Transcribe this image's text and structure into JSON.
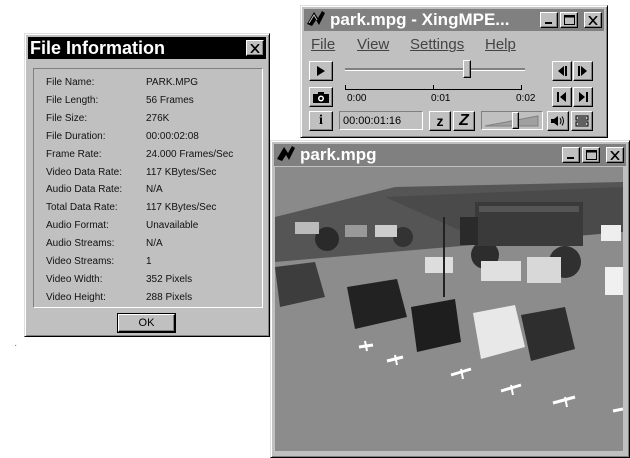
{
  "file_info": {
    "title": "File Information",
    "close_label": "✕",
    "rows": [
      {
        "label": "File Name:",
        "value": "PARK.MPG"
      },
      {
        "label": "File Length:",
        "value": "56 Frames"
      },
      {
        "label": "File Size:",
        "value": "276K"
      },
      {
        "label": "File Duration:",
        "value": "00:00:02:08"
      },
      {
        "label": "Frame Rate:",
        "value": "24.000 Frames/Sec"
      },
      {
        "label": "Video Data Rate:",
        "value": "117 KBytes/Sec"
      },
      {
        "label": "Audio Data Rate:",
        "value": "N/A"
      },
      {
        "label": "Total Data Rate:",
        "value": "117 KBytes/Sec"
      },
      {
        "label": "Audio Format:",
        "value": "Unavailable"
      },
      {
        "label": "Audio Streams:",
        "value": "N/A"
      },
      {
        "label": "Video Streams:",
        "value": "1"
      },
      {
        "label": "Video Width:",
        "value": "352 Pixels"
      },
      {
        "label": "Video Height:",
        "value": "288 Pixels"
      }
    ],
    "ok_label": "OK"
  },
  "player": {
    "title": "park.mpg - XingMPE...",
    "menu": [
      "File",
      "View",
      "Settings",
      "Help"
    ],
    "time_marks": [
      "0:00",
      "0:01",
      "0:02"
    ],
    "position_display": "00:00:01:16",
    "zoom_small_label": "z",
    "zoom_large_label": "Z",
    "seek_position_fraction": 0.68,
    "volume_fraction": 0.55
  },
  "video_window": {
    "title": "park.mpg"
  },
  "icons": {
    "minimize": "minimize-icon",
    "maximize": "maximize-icon",
    "close": "close-icon",
    "play": "play-icon",
    "snapshot": "camera-icon",
    "info": "info-icon",
    "step_back": "step-back-icon",
    "step_forward": "step-forward-icon",
    "go_start": "skip-to-start-icon",
    "go_end": "skip-to-end-icon",
    "speaker": "speaker-icon",
    "display": "display-icon",
    "app": "xing-logo-icon"
  }
}
